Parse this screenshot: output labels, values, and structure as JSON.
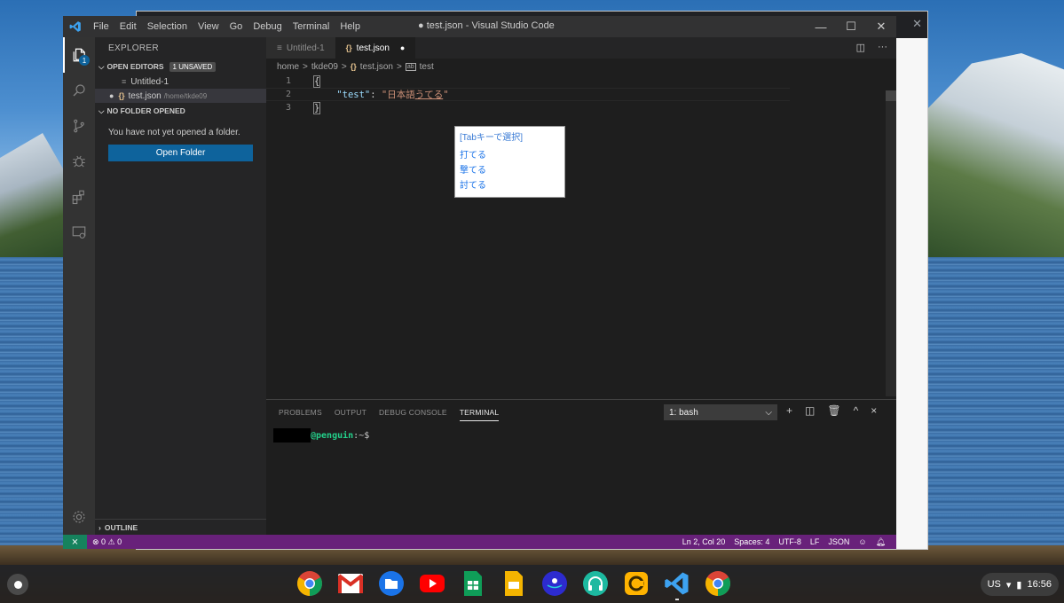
{
  "titlebar": {
    "menu": [
      "File",
      "Edit",
      "Selection",
      "View",
      "Go",
      "Debug",
      "Terminal",
      "Help"
    ],
    "window_title": "● test.json - Visual Studio Code"
  },
  "sidebar": {
    "title": "EXPLORER",
    "open_editors": {
      "label": "OPEN EDITORS",
      "badge": "1 UNSAVED"
    },
    "files": [
      {
        "name": "Untitled-1",
        "path": ""
      },
      {
        "name": "test.json",
        "path": "/home/tkde09"
      }
    ],
    "no_folder": {
      "label": "NO FOLDER OPENED",
      "message": "You have not yet opened a folder.",
      "button": "Open Folder"
    },
    "outline_label": "OUTLINE",
    "explorer_badge": "1"
  },
  "tabs": [
    {
      "label": "Untitled-1"
    },
    {
      "label": "test.json",
      "dirty": "●"
    }
  ],
  "breadcrumb": {
    "home": "home",
    "user": "tkde09",
    "file": "test.json",
    "key": "test",
    "sep": ">"
  },
  "editor": {
    "line_numbers": [
      "1",
      "2",
      "3"
    ],
    "open_brace": "{",
    "close_brace": "}",
    "key": "\"test\"",
    "colon": ": ",
    "value_prefix": "\"日本語",
    "value_composing": "うてる",
    "value_suffix": "\""
  },
  "ime": {
    "header": "[Tabキーで選択]",
    "candidates": [
      "打てる",
      "撃てる",
      "討てる"
    ]
  },
  "panel": {
    "tabs": [
      "PROBLEMS",
      "OUTPUT",
      "DEBUG CONSOLE",
      "TERMINAL"
    ],
    "active_tab": "TERMINAL",
    "terminal_select": "1: bash",
    "prompt_host": "@penguin",
    "prompt_rest": ":~$"
  },
  "statusbar": {
    "problems": "⊗ 0 ⚠ 0",
    "position": "Ln 2, Col 20",
    "spaces": "Spaces: 4",
    "encoding": "UTF-8",
    "eol": "LF",
    "language": "JSON"
  },
  "shelf": {
    "locale": "US",
    "time": "16:56"
  },
  "colors": {
    "statusbar": "#68217a",
    "accent": "#0e639c"
  }
}
